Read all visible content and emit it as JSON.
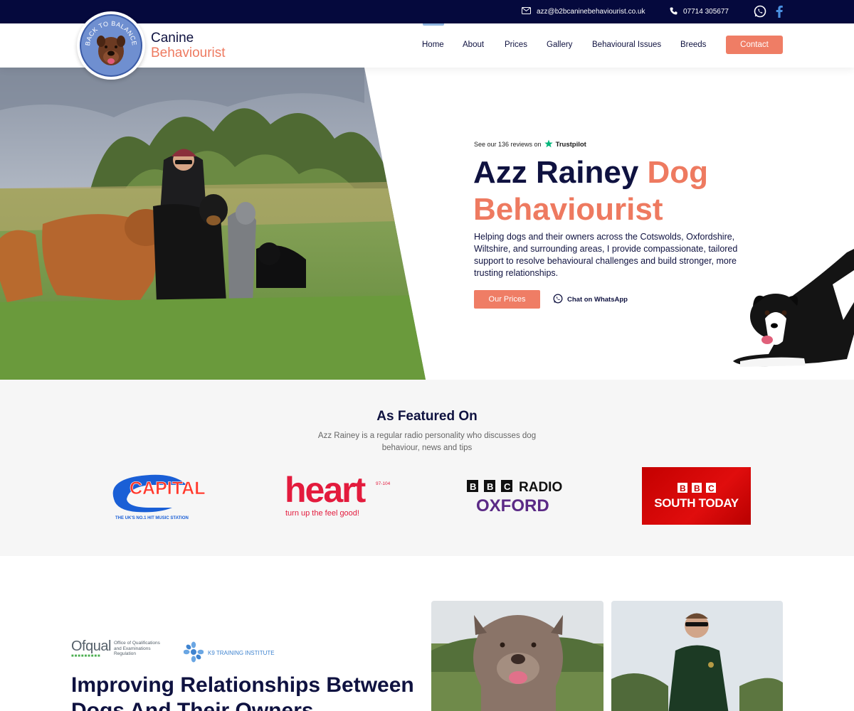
{
  "topbar": {
    "email": "azz@b2bcaninebehaviourist.co.uk",
    "phone": "07714 305677"
  },
  "brand": {
    "title": "Canine",
    "subtitle": "Behaviourist",
    "badge_text": "BACK TO BALANCE"
  },
  "nav": {
    "items": [
      "Home",
      "About",
      "Prices",
      "Gallery",
      "Behavioural Issues",
      "Breeds"
    ],
    "active": "Home",
    "contact_label": "Contact"
  },
  "hero": {
    "trust_prefix": "See our 136 reviews on",
    "trust_brand": "Trustpilot",
    "heading_part1": "Azz Rainey",
    "heading_part2": "Dog",
    "heading_part3": "Behaviourist",
    "text": "Helping dogs and their owners across the Cotswolds, Oxfordshire, Wiltshire, and surrounding areas, I provide compassionate, tailored support to resolve behavioural challenges and build stronger, more trusting relationships.",
    "prices_button": "Our Prices",
    "whatsapp_link": "Chat on WhatsApp"
  },
  "featured": {
    "title": "As Featured On",
    "subtitle": "Azz Rainey is a regular radio personality who discusses dog behaviour, news and tips",
    "capital": {
      "name": "CAPITAL",
      "tagline": "THE UK'S NO.1 HIT MUSIC STATION"
    },
    "heart": {
      "name": "heart",
      "freq": "97-104",
      "tagline": "turn up the feel good!"
    },
    "bbc_oxford": {
      "letters": [
        "B",
        "B",
        "C"
      ],
      "word": "RADIO",
      "place": "OXFORD"
    },
    "bbc_south": {
      "letters": [
        "B",
        "B",
        "C"
      ],
      "name": "SOUTH TODAY"
    }
  },
  "accreditations": {
    "ofqual_name": "Ofqual",
    "ofqual_desc": "Office of Qualifications and Examinations Regulation",
    "k9_name": "K9 TRAINING INSTITUTE"
  },
  "lower": {
    "heading": "Improving Relationships Between Dogs And Their Owners"
  },
  "colors": {
    "navy": "#05093d",
    "heading": "#0f1240",
    "accent": "#ee7a60",
    "trustpilot_green": "#00b67a"
  }
}
